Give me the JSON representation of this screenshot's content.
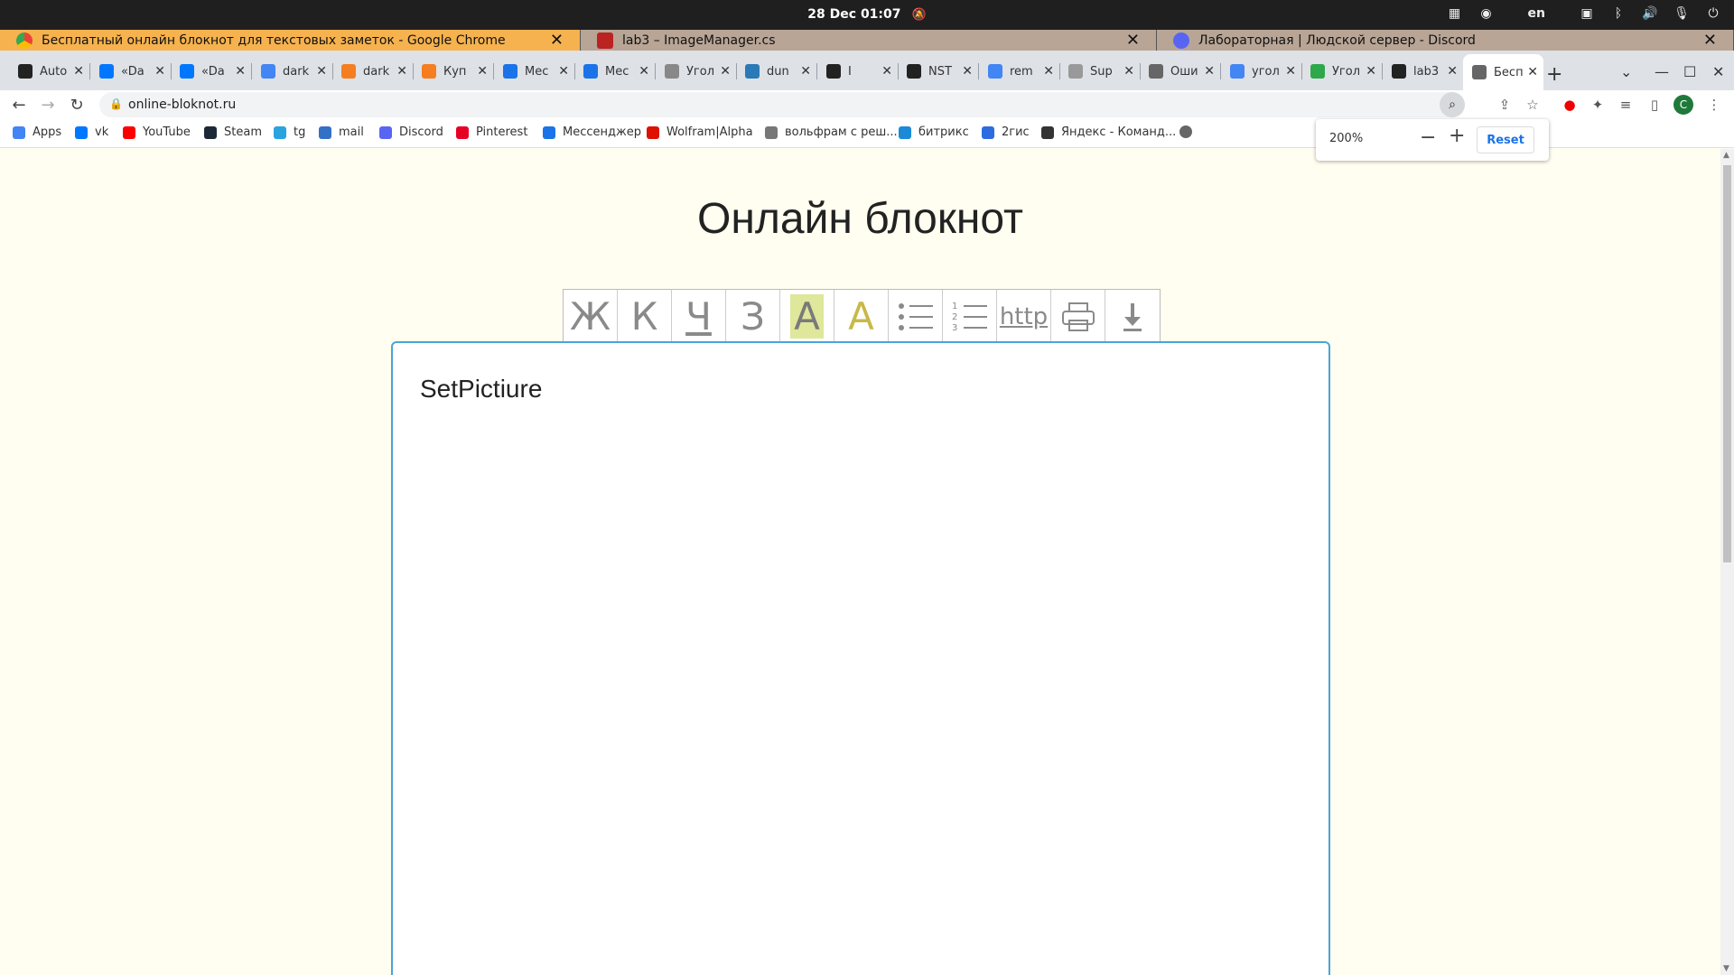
{
  "os": {
    "datetime": "28 Dec  01:07",
    "lang": "en"
  },
  "windows": [
    {
      "title": "Бесплатный онлайн блокнот для текстовых заметок - Google Chrome",
      "icon": "chrome-icon",
      "active": true
    },
    {
      "title": "lab3 – ImageManager.cs",
      "icon": "rider-icon",
      "active": false
    },
    {
      "title": "Лабораторная | Людской сервер - Discord",
      "icon": "discord-icon",
      "active": false
    }
  ],
  "tabs": [
    {
      "label": "Auto",
      "icon": "github-icon"
    },
    {
      "label": "«Da",
      "icon": "vk-icon"
    },
    {
      "label": "«Da",
      "icon": "vk-icon"
    },
    {
      "label": "dark",
      "icon": "google-icon"
    },
    {
      "label": "dark",
      "icon": "dns-icon"
    },
    {
      "label": "Куп",
      "icon": "dns-icon"
    },
    {
      "label": "Мес",
      "icon": "messenger-icon"
    },
    {
      "label": "Мес",
      "icon": "messenger-icon"
    },
    {
      "label": "Угол",
      "icon": "translate-icon"
    },
    {
      "label": "dun",
      "icon": "chat-icon"
    },
    {
      "label": "I",
      "icon": "youtube-icon"
    },
    {
      "label": "NST",
      "icon": "github-icon"
    },
    {
      "label": "rem",
      "icon": "google-icon"
    },
    {
      "label": "Sup",
      "icon": "wolfram-icon"
    },
    {
      "label": "Оши",
      "icon": "ai-icon"
    },
    {
      "label": "угол",
      "icon": "google-icon"
    },
    {
      "label": "Угол",
      "icon": "green-icon"
    },
    {
      "label": "lab3",
      "icon": "github-icon"
    },
    {
      "label": "Бесп",
      "icon": "page-icon"
    }
  ],
  "address": {
    "url": "online-bloknot.ru"
  },
  "bookmarks": [
    {
      "label": "Apps",
      "icon": "apps-icon",
      "color": "#4285f4"
    },
    {
      "label": "vk",
      "icon": "vk-icon",
      "color": "#0077ff"
    },
    {
      "label": "YouTube",
      "icon": "youtube-icon",
      "color": "#ff0000"
    },
    {
      "label": "Steam",
      "icon": "steam-icon",
      "color": "#1b2838"
    },
    {
      "label": "tg",
      "icon": "telegram-icon",
      "color": "#2aa3de"
    },
    {
      "label": "mail",
      "icon": "mail-icon",
      "color": "#3470c6"
    },
    {
      "label": "Discord",
      "icon": "discord-icon",
      "color": "#5865f2"
    },
    {
      "label": "Pinterest",
      "icon": "pinterest-icon",
      "color": "#e60023"
    },
    {
      "label": "Мессенджер",
      "icon": "messenger-icon",
      "color": "#1a73e8"
    },
    {
      "label": "Wolfram|Alpha",
      "icon": "wolfram-icon",
      "color": "#dd1100"
    },
    {
      "label": "вольфрам с реш...",
      "icon": "wolfram2-icon",
      "color": "#777777"
    },
    {
      "label": "битрикс",
      "icon": "bitrix-icon",
      "color": "#1c8ad6"
    },
    {
      "label": "2гис",
      "icon": "2gis-icon",
      "color": "#2c6ce0"
    },
    {
      "label": "Яндекс - Команд...",
      "icon": "yandex-icon",
      "color": "#333333"
    },
    {
      "label": "",
      "icon": "globe-icon",
      "color": "#666666"
    }
  ],
  "zoom": {
    "value": "200%",
    "minus": "−",
    "plus": "+",
    "reset": "Reset"
  },
  "page": {
    "title": "Онлайн блокнот",
    "toolbar": [
      "Ж",
      "К",
      "Ч",
      "З",
      "A",
      "A",
      "list",
      "numlist",
      "http",
      "print",
      "download"
    ],
    "editor_text": "SetPictiure"
  }
}
